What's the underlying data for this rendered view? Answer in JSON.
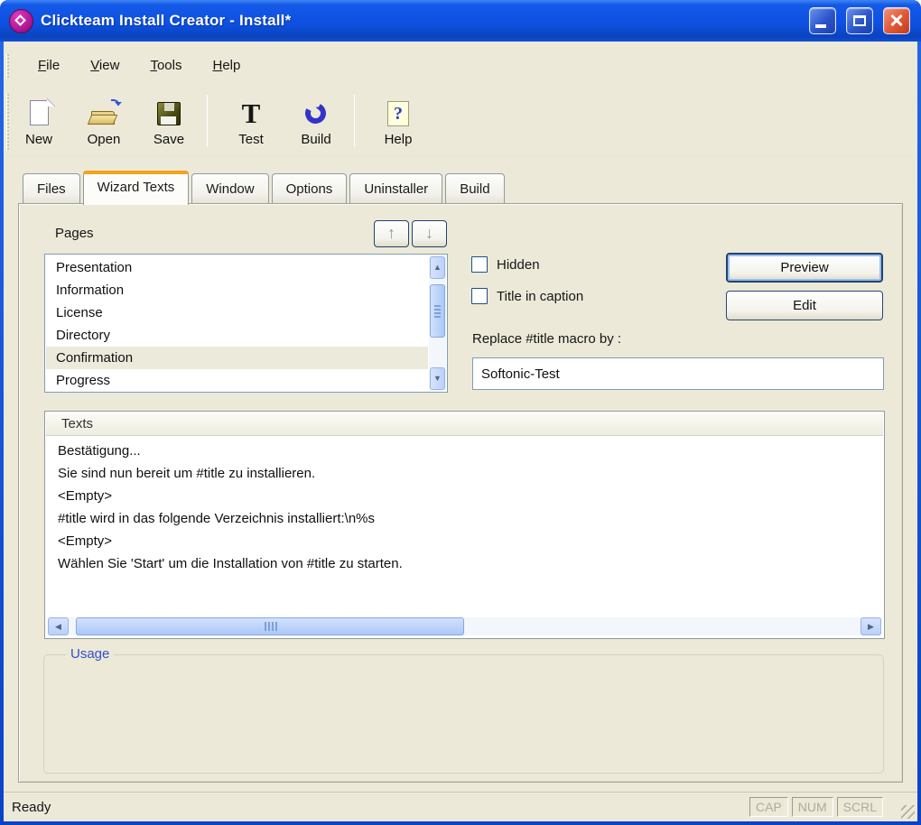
{
  "window": {
    "title": "Clickteam Install Creator - Install*"
  },
  "menubar": {
    "items": [
      "File",
      "View",
      "Tools",
      "Help"
    ]
  },
  "toolbar": {
    "items": [
      "New",
      "Open",
      "Save",
      "Test",
      "Build",
      "Help"
    ]
  },
  "tabs": {
    "items": [
      "Files",
      "Wizard Texts",
      "Window",
      "Options",
      "Uninstaller",
      "Build"
    ],
    "active": "Wizard Texts"
  },
  "wizard": {
    "pages_label": "Pages",
    "pages": [
      "Presentation",
      "Information",
      "License",
      "Directory",
      "Confirmation",
      "Progress"
    ],
    "selected_page": "Confirmation",
    "hidden_label": "Hidden",
    "title_in_caption_label": "Title in caption",
    "preview_button": "Preview",
    "edit_button": "Edit",
    "replace_label": "Replace #title macro by :",
    "replace_value": "Softonic-Test",
    "texts_header": "Texts",
    "texts": [
      "Bestätigung...",
      "Sie sind nun bereit um #title zu installieren.",
      "<Empty>",
      "#title wird in das folgende Verzeichnis installiert:\\n%s",
      "<Empty>",
      "Wählen Sie 'Start' um die Installation von #title zu starten."
    ],
    "usage_label": "Usage"
  },
  "statusbar": {
    "status": "Ready",
    "indicators": [
      "CAP",
      "NUM",
      "SCRL"
    ]
  },
  "colors": {
    "titlebar_blue": "#0E51E2",
    "client_beige": "#ECE9D8",
    "active_tab_accent": "#F2A41C",
    "groupbox_label_blue": "#3050C8",
    "selection_inactive": "#ECEADB"
  }
}
